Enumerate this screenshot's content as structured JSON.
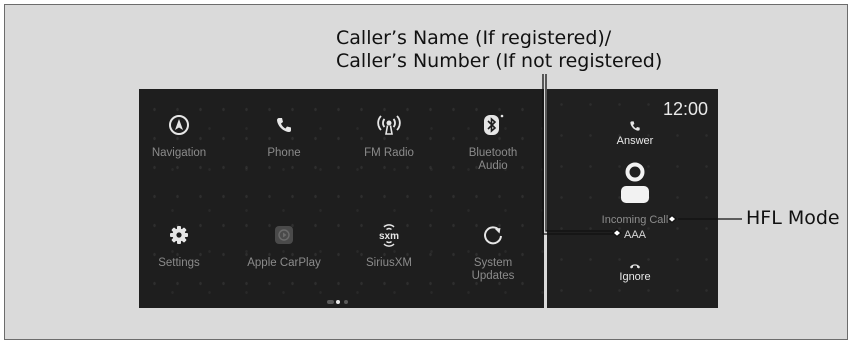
{
  "callouts": {
    "caller_line1": "Caller’s Name (If registered)/",
    "caller_line2": "Caller’s Number (If not registered)",
    "hfl_mode": "HFL Mode"
  },
  "home_screen": {
    "apps": [
      {
        "label": "Navigation",
        "icon": "navigation-icon"
      },
      {
        "label": "Phone",
        "icon": "phone-icon"
      },
      {
        "label": "FM Radio",
        "icon": "radio-icon"
      },
      {
        "label": "Bluetooth\nAudio",
        "icon": "bluetooth-icon"
      },
      {
        "label": "Settings",
        "icon": "gear-icon"
      },
      {
        "label": "Apple CarPlay",
        "icon": "carplay-icon"
      },
      {
        "label": "SiriusXM",
        "icon": "siriusxm-icon",
        "icon_text": "sxm"
      },
      {
        "label": "System\nUpdates",
        "icon": "refresh-icon"
      }
    ],
    "page_indicator": {
      "pages": 3,
      "active": 2
    }
  },
  "call_panel": {
    "time": "12:00",
    "answer_label": "Answer",
    "incoming_label": "Incoming Call",
    "caller": "AAA",
    "ignore_label": "Ignore"
  },
  "colors": {
    "screen_bg": "#1e1e1e",
    "icon": "#e6e6e6",
    "dim_label": "#8b8b8b",
    "leader": "#111111"
  }
}
